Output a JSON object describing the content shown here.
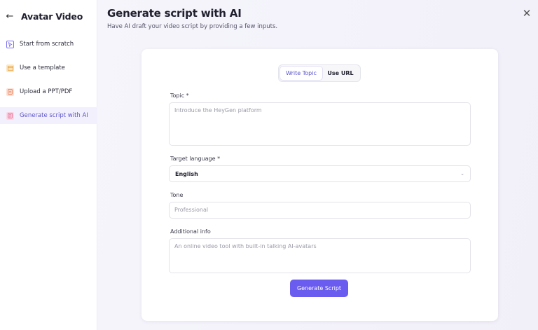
{
  "sidebar": {
    "title": "Avatar Video",
    "back_icon": "arrow-left-icon",
    "items": [
      {
        "label": "Start from scratch",
        "icon": "cursor-icon",
        "color": "#7a6ff0"
      },
      {
        "label": "Use a template",
        "icon": "template-icon",
        "color": "#e9a23b"
      },
      {
        "label": "Upload a PPT/PDF",
        "icon": "document-icon",
        "color": "#e8734a"
      },
      {
        "label": "Generate script with AI",
        "icon": "ai-script-icon",
        "color": "#e05a8a",
        "active": true
      }
    ]
  },
  "header": {
    "title": "Generate script with AI",
    "subtitle": "Have AI draft your video script by providing a few inputs.",
    "close_icon": "close-icon"
  },
  "form": {
    "tabs": [
      {
        "label": "Write Topic",
        "active": true
      },
      {
        "label": "Use URL",
        "active": false
      }
    ],
    "topic": {
      "label": "Topic *",
      "placeholder": "Introduce the HeyGen platform"
    },
    "language": {
      "label": "Target language *",
      "value": "English"
    },
    "tone": {
      "label": "Tone",
      "placeholder": "Professional"
    },
    "additional": {
      "label": "Additional info",
      "placeholder": "An online video tool with built-in talking AI-avatars"
    },
    "submit_label": "Generate Script"
  },
  "colors": {
    "accent": "#6b5cf0",
    "active_bg": "#f3f0fe",
    "active_text": "#5b54c9"
  }
}
